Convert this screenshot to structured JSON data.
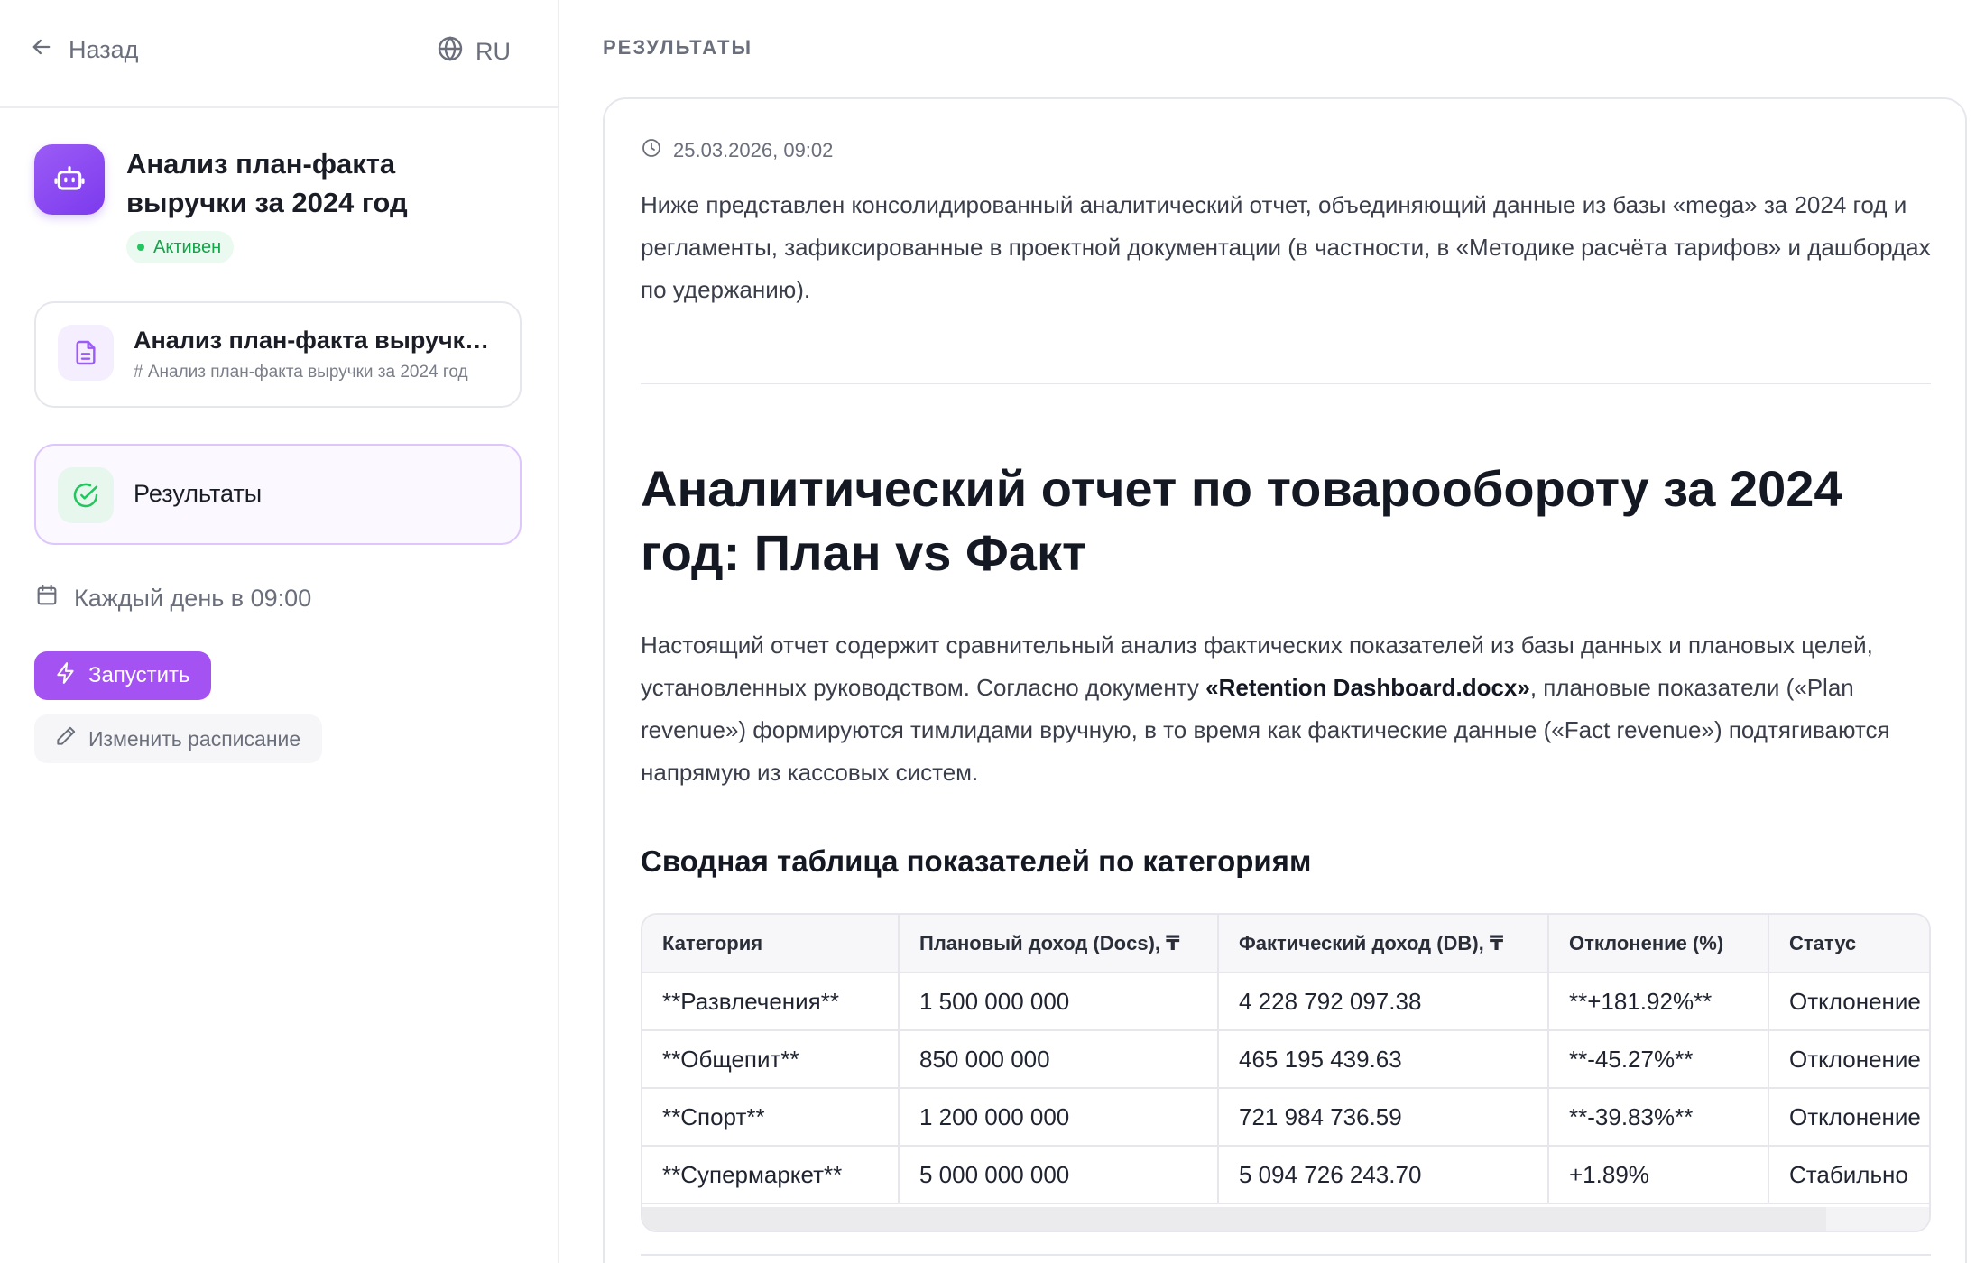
{
  "sidebar": {
    "back_label": "Назад",
    "lang_label": "RU",
    "agent": {
      "title": "Анализ план-факта выручки за 2024 год",
      "status": "Активен"
    },
    "doc_card": {
      "title": "Анализ план-факта выручки за 2024 год",
      "subtitle": "# Анализ план-факта выручки за 2024 год"
    },
    "results_card": {
      "title": "Результаты"
    },
    "schedule": "Каждый день в 09:00",
    "run_button": "Запустить",
    "edit_schedule_button": "Изменить расписание"
  },
  "main": {
    "section_label": "РЕЗУЛЬТАТЫ",
    "timestamp": "25.03.2026, 09:02",
    "intro": "Ниже представлен консолидированный аналитический отчет, объединяющий данные из базы «mega» за 2024 год и регламенты, зафиксированные в проектной документации (в частности, в «Методике расчёта тарифов» и дашбордах по удержанию).",
    "heading": "Аналитический отчет по товарообороту за 2024 год: План vs Факт",
    "paragraph": {
      "before": "Настоящий отчет содержит сравнительный анализ фактических показателей из базы данных и плановых целей, установленных руководством. Согласно документу ",
      "bold": "«Retention Dashboard.docx»",
      "after": ", плановые показатели («Plan revenue») формируются тимлидами вручную, в то время как фактические данные («Fact revenue») подтягиваются напрямую из кассовых систем."
    },
    "table_heading": "Сводная таблица показателей по категориям",
    "table": {
      "headers": [
        "Категория",
        "Плановый доход (Docs), ₸",
        "Фактический доход (DB), ₸",
        "Отклонение (%)",
        "Статус"
      ],
      "rows": [
        [
          "**Развлечения**",
          "1 500 000 000",
          "4 228 792 097.38",
          "**+181.92%**",
          "Отклонение"
        ],
        [
          "**Общепит**",
          "850 000 000",
          "465 195 439.63",
          "**-45.27%**",
          "Отклонение"
        ],
        [
          "**Спорт**",
          "1 200 000 000",
          "721 984 736.59",
          "**-39.83%**",
          "Отклонение"
        ],
        [
          "**Супермаркет**",
          "5 000 000 000",
          "5 094 726 243.70",
          "+1.89%",
          "Стабильно"
        ]
      ]
    }
  },
  "colors": {
    "accent": "#a453f2",
    "active_green": "#16a34a",
    "results_border": "#ddc6fb"
  }
}
